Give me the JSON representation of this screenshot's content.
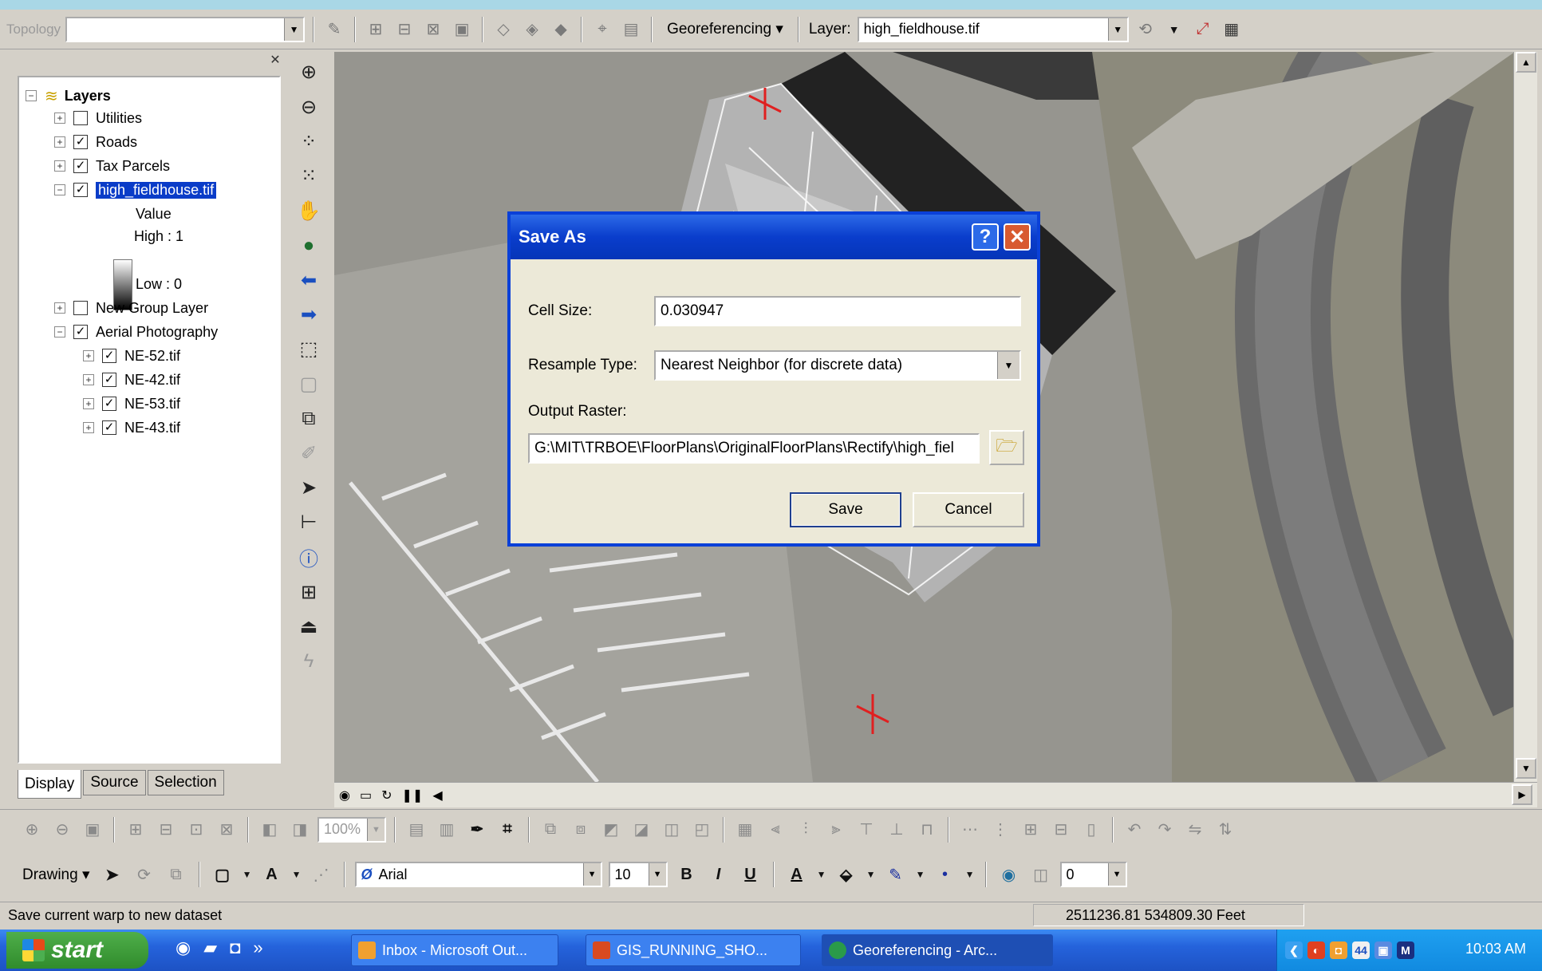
{
  "toolbar_top": {
    "topology_label": "Topology",
    "georef_menu": "Georeferencing",
    "layer_label": "Layer:",
    "layer_value": "high_fieldhouse.tif"
  },
  "toc": {
    "root_label": "Layers",
    "layers": [
      {
        "label": "Utilities",
        "checked": false
      },
      {
        "label": "Roads",
        "checked": true
      },
      {
        "label": "Tax Parcels",
        "checked": true
      },
      {
        "label": "high_fieldhouse.tif",
        "checked": true,
        "selected": true
      },
      {
        "label": "New Group Layer",
        "checked": false
      },
      {
        "label": "Aerial Photography",
        "checked": true
      }
    ],
    "legend": {
      "title": "Value",
      "high": "High : 1",
      "low": "Low : 0"
    },
    "sublayers": [
      {
        "label": "NE-52.tif",
        "checked": true
      },
      {
        "label": "NE-42.tif",
        "checked": true
      },
      {
        "label": "NE-53.tif",
        "checked": true
      },
      {
        "label": "NE-43.tif",
        "checked": true
      }
    ],
    "tabs": [
      "Display",
      "Source",
      "Selection"
    ]
  },
  "dialog": {
    "title": "Save As",
    "help_symbol": "?",
    "close_symbol": "✕",
    "cell_size_label": "Cell Size:",
    "cell_size_value": "0.030947",
    "resample_label": "Resample Type:",
    "resample_value": "Nearest Neighbor (for discrete data)",
    "output_label": "Output Raster:",
    "output_value": "G:\\MIT\\TRBOE\\FloorPlans\\OriginalFloorPlans\\Rectify\\high_fiel",
    "save_label": "Save",
    "cancel_label": "Cancel"
  },
  "drawing_toolbar": {
    "drawing_menu": "Drawing",
    "font_name": "Arial",
    "font_size": "10",
    "bold": "B",
    "italic": "I",
    "underline": "U",
    "offset_value": "0",
    "zoom_value": "100%"
  },
  "status": {
    "message": "Save current warp to new dataset",
    "coords": "2511236.81  534809.30 Feet"
  },
  "taskbar": {
    "start_label": "start",
    "tasks": [
      "Inbox - Microsoft Out...",
      "GIS_RUNNING_SHO...",
      "Georeferencing - Arc..."
    ],
    "tray_badge": "44",
    "clock": "10:03 AM"
  },
  "colors": {
    "selection_blue": "#0a3cc8",
    "xp_taskbar": "#2563dc",
    "start_green": "#308c2c",
    "dialog_title": "#0a3dcc"
  }
}
